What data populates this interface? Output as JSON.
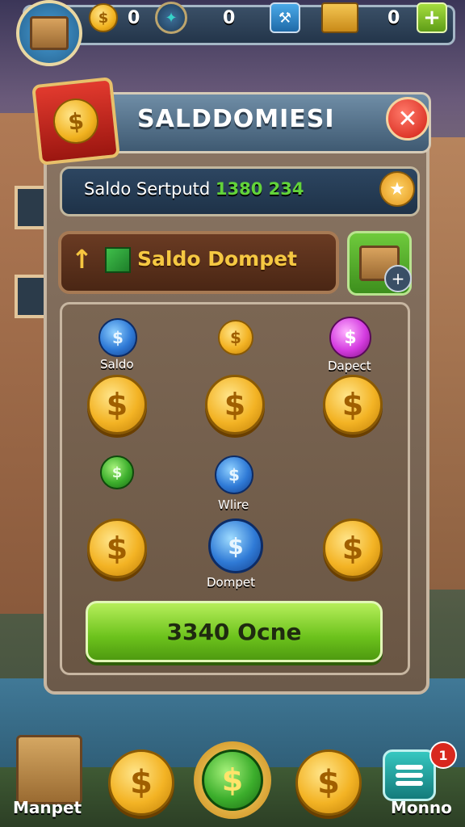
{
  "topbar": {
    "coins_value": "0",
    "gems_value": "0",
    "bars_value": "0",
    "coin_glyph": "$",
    "plus_glyph": "+"
  },
  "dialog": {
    "title": "SALDDOMIESI",
    "close_glyph": "✕",
    "saldo_label": "Saldo Sertputd",
    "saldo_value": "1380 234",
    "dompet_label": "Saldo Dompet",
    "confirm_button": "3340 Ocne"
  },
  "grid": {
    "labels": {
      "saldo": "Saldo",
      "dapect": "Dapect",
      "wlire": "Wlire",
      "dompet": "Dompet"
    }
  },
  "bottom": {
    "left_label": "Manpet",
    "right_label": "Monno",
    "notification_count": "1"
  },
  "icons": {
    "coin": "dollar-coin-icon",
    "close": "close-icon",
    "star": "star-icon",
    "menu": "menu-icon"
  },
  "colors": {
    "accent_green": "#6cc21c",
    "gold": "#f3b324",
    "title_blue": "#3f5a72"
  }
}
